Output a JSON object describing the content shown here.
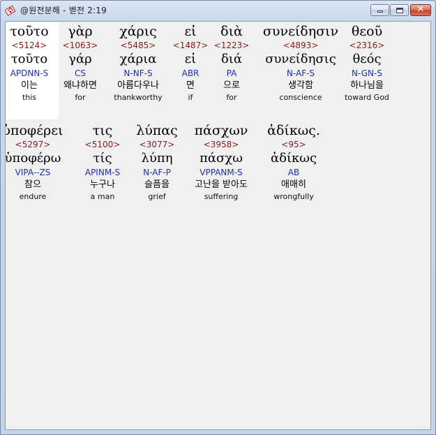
{
  "window": {
    "title": "@원전분해 - 벧전 2:19"
  },
  "lines": [
    {
      "words": [
        {
          "greek": "τοῦτο",
          "strong": "<5124>",
          "lemma": "τοῦτο",
          "parse": "APDNN-S",
          "korean": "이는",
          "english": "this"
        },
        {
          "greek": "γὰρ",
          "strong": "<1063>",
          "lemma": "γάρ",
          "parse": "CS",
          "korean": "왜냐하면",
          "english": "for"
        },
        {
          "greek": "χάρις",
          "strong": "<5485>",
          "lemma": "χάρια",
          "parse": "N-NF-S",
          "korean": "아름다우나",
          "english": "thankworthy"
        },
        {
          "greek": "εἰ",
          "strong": "<1487>",
          "lemma": "εἰ",
          "parse": "ABR",
          "korean": "면",
          "english": "if"
        },
        {
          "greek": "διὰ",
          "strong": "<1223>",
          "lemma": "διά",
          "parse": "PA",
          "korean": "으로",
          "english": "for"
        },
        {
          "greek": "συνείδησιν",
          "strong": "<4893>",
          "lemma": "συνείδησις",
          "parse": "N-AF-S",
          "korean": "생각함",
          "english": "conscience"
        },
        {
          "greek": "θεοῦ",
          "strong": "<2316>",
          "lemma": "θεός",
          "parse": "N-GN-S",
          "korean": "하나님을",
          "english": "toward God"
        }
      ]
    },
    {
      "words": [
        {
          "greek": "ὑποφέρει",
          "strong": "<5297>",
          "lemma": "ὑποφέρω",
          "parse": "VIPA--ZS",
          "korean": "참으",
          "english": "endure"
        },
        {
          "greek": "τις",
          "strong": "<5100>",
          "lemma": "τίς",
          "parse": "APINM-S",
          "korean": "누구나",
          "english": "a man"
        },
        {
          "greek": "λύπας",
          "strong": "<3077>",
          "lemma": "λύπη",
          "parse": "N-AF-P",
          "korean": "슬픔을",
          "english": "grief"
        },
        {
          "greek": "πάσχων",
          "strong": "<3958>",
          "lemma": "πάσχω",
          "parse": "VPPANM-S",
          "korean": "고난을 받아도",
          "english": "suffering"
        },
        {
          "greek": "ἀδίκως.",
          "strong": "<95>",
          "lemma": "ἀδίκως",
          "parse": "AB",
          "korean": "애매히",
          "english": "wrongfully"
        }
      ]
    }
  ]
}
